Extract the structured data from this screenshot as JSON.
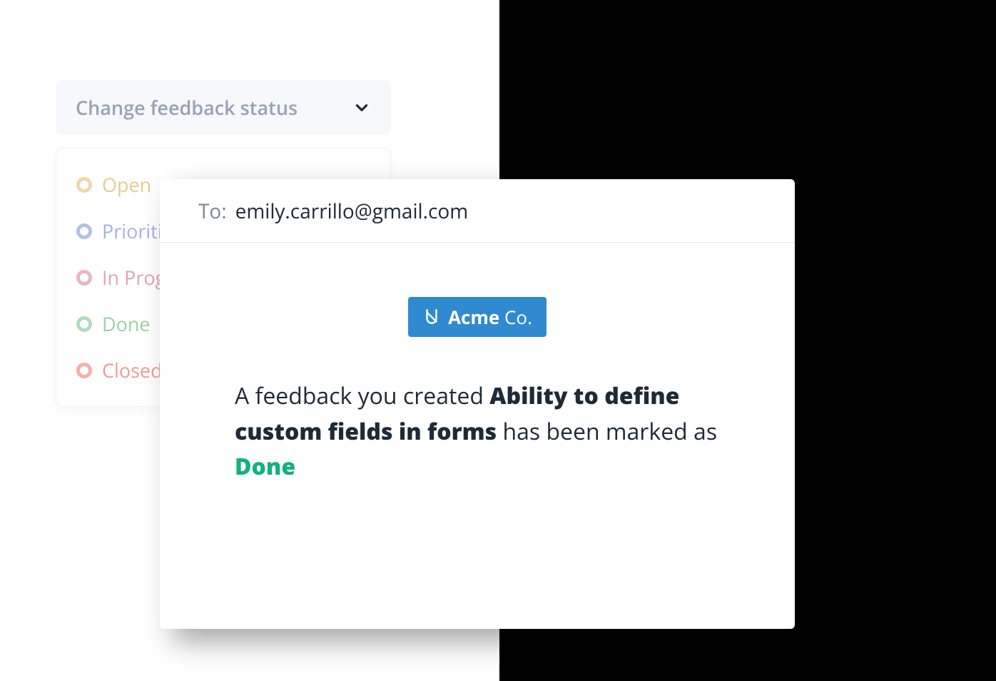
{
  "dropdown": {
    "label": "Change feedback status",
    "items": [
      {
        "label": "Open"
      },
      {
        "label": "Prioritised"
      },
      {
        "label": "In Progress"
      },
      {
        "label": "Done"
      },
      {
        "label": "Closed"
      }
    ]
  },
  "email": {
    "to_label": "To:",
    "to_email": "emily.carrillo@gmail.com",
    "logo_brand": "Acme",
    "logo_suffix": " Co.",
    "message_1": "A feedback you created ",
    "message_title": "Ability to define custom fields in forms",
    "message_2": " has been marked as ",
    "message_status": "Done"
  }
}
